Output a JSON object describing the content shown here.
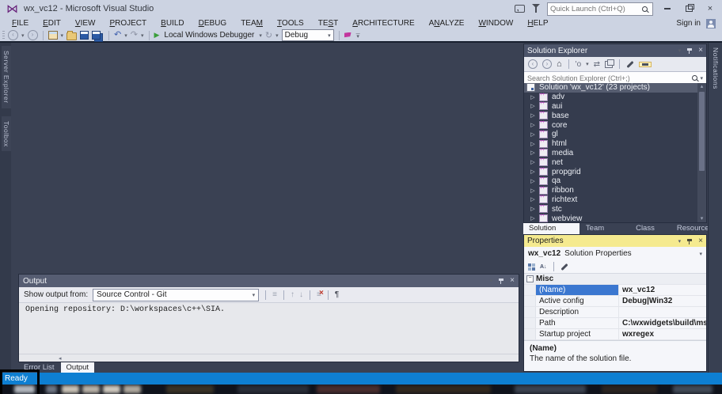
{
  "window": {
    "title": "wx_vc12 - Microsoft Visual Studio",
    "quick_launch_placeholder": "Quick Launch (Ctrl+Q)",
    "sign_in": "Sign in"
  },
  "menu": {
    "items": [
      {
        "label": "FILE",
        "u": 0
      },
      {
        "label": "EDIT",
        "u": 0
      },
      {
        "label": "VIEW",
        "u": 0
      },
      {
        "label": "PROJECT",
        "u": 0
      },
      {
        "label": "BUILD",
        "u": 0
      },
      {
        "label": "DEBUG",
        "u": 0
      },
      {
        "label": "TEAM",
        "u": 3
      },
      {
        "label": "TOOLS",
        "u": 0
      },
      {
        "label": "TEST",
        "u": 2
      },
      {
        "label": "ARCHITECTURE",
        "u": 0
      },
      {
        "label": "ANALYZE",
        "u": 1
      },
      {
        "label": "WINDOW",
        "u": 0
      },
      {
        "label": "HELP",
        "u": 0
      }
    ]
  },
  "toolbar": {
    "debugger_label": "Local Windows Debugger",
    "config_value": "Debug"
  },
  "left_tabs": [
    "Server Explorer",
    "Toolbox"
  ],
  "right_tab": "Notifications",
  "solution_explorer": {
    "title": "Solution Explorer",
    "search_placeholder": "Search Solution Explorer (Ctrl+;)",
    "root": "Solution 'wx_vc12'  (23 projects)",
    "projects": [
      "adv",
      "aui",
      "base",
      "core",
      "gl",
      "html",
      "media",
      "net",
      "propgrid",
      "qa",
      "ribbon",
      "richtext",
      "stc",
      "webview"
    ],
    "tabs": [
      {
        "label": "Solution Explorer",
        "active": true
      },
      {
        "label": "Team Explorer",
        "active": false
      },
      {
        "label": "Class View",
        "active": false
      },
      {
        "label": "Resource View",
        "active": false
      }
    ]
  },
  "properties": {
    "title": "Properties",
    "object_name": "wx_vc12",
    "object_type": "Solution Properties",
    "category": "Misc",
    "rows": [
      {
        "label": "(Name)",
        "value": "wx_vc12",
        "selected": true
      },
      {
        "label": "Active config",
        "value": "Debug|Win32",
        "selected": false
      },
      {
        "label": "Description",
        "value": "",
        "selected": false
      },
      {
        "label": "Path",
        "value": "C:\\wxwidgets\\build\\msw\\wx_v",
        "selected": false
      },
      {
        "label": "Startup project",
        "value": "wxregex",
        "selected": false
      }
    ],
    "help_title": "(Name)",
    "help_text": "The name of the solution file."
  },
  "output": {
    "title": "Output",
    "show_from": "Show output from:",
    "source_value": "Source Control - Git",
    "content": "Opening repository: D:\\workspaces\\c++\\SIA.",
    "tabs": [
      {
        "label": "Error List",
        "active": false
      },
      {
        "label": "Output",
        "active": true
      }
    ]
  },
  "status_bar": {
    "text": "Ready"
  },
  "colors": {
    "chrome": "#ccd3e2",
    "main_background": "#3a4153",
    "active_title": "#f5ea8f",
    "status_blue": "#0e7fd2",
    "selection_blue": "#3b77d0",
    "logo_purple": "#68217a"
  },
  "icons": {
    "expander": "▷",
    "caret_down": "▾",
    "caret_up": "▴",
    "close": "×",
    "undo": "↶",
    "redo": "↷",
    "play": "▶",
    "home": "⌂",
    "sync": "⇄",
    "pending_filter": "'o",
    "lines": "≡",
    "arrow_up": "↑",
    "arrow_down": "↓",
    "wrap": "¶",
    "arrow_left": "◂",
    "minus": "−"
  }
}
